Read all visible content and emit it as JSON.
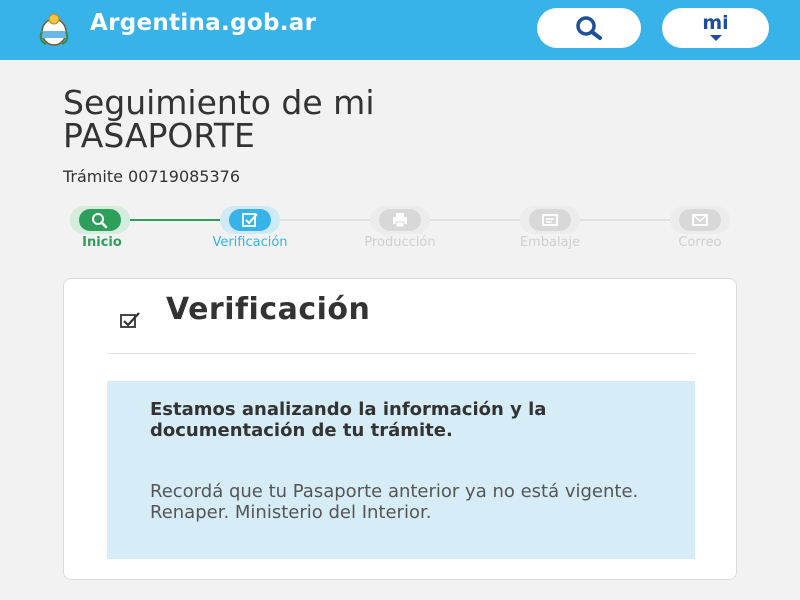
{
  "header": {
    "brand": "Argentina.gob.ar",
    "search_icon": "search-icon",
    "mi_label": "mi",
    "colors": {
      "bar": "#37b3e9",
      "mi": "#1f4e9b"
    }
  },
  "page": {
    "title_line1": "Seguimiento de mi",
    "title_line2": "PASAPORTE",
    "tramite": "Trámite 00719085376"
  },
  "stepper": {
    "steps": [
      {
        "label": "Inicio",
        "state": "done",
        "icon": "search-icon"
      },
      {
        "label": "Verificación",
        "state": "active",
        "icon": "checkbox-icon"
      },
      {
        "label": "Producción",
        "state": "pending",
        "icon": "printer-icon"
      },
      {
        "label": "Embalaje",
        "state": "pending",
        "icon": "package-icon"
      },
      {
        "label": "Correo",
        "state": "pending",
        "icon": "envelope-icon"
      }
    ],
    "colors": {
      "done": "#2e9e5b",
      "active": "#37b3e9",
      "pending": "#d8d8d8"
    }
  },
  "card": {
    "title": "Verificación",
    "icon": "checkbox-icon",
    "info_strong": "Estamos analizando la información y la documentación de tu trámite.",
    "info_text": "Recordá que tu Pasaporte anterior ya no está vigente. Renaper. Ministerio del Interior.",
    "info_bg": "#d6edf8"
  }
}
